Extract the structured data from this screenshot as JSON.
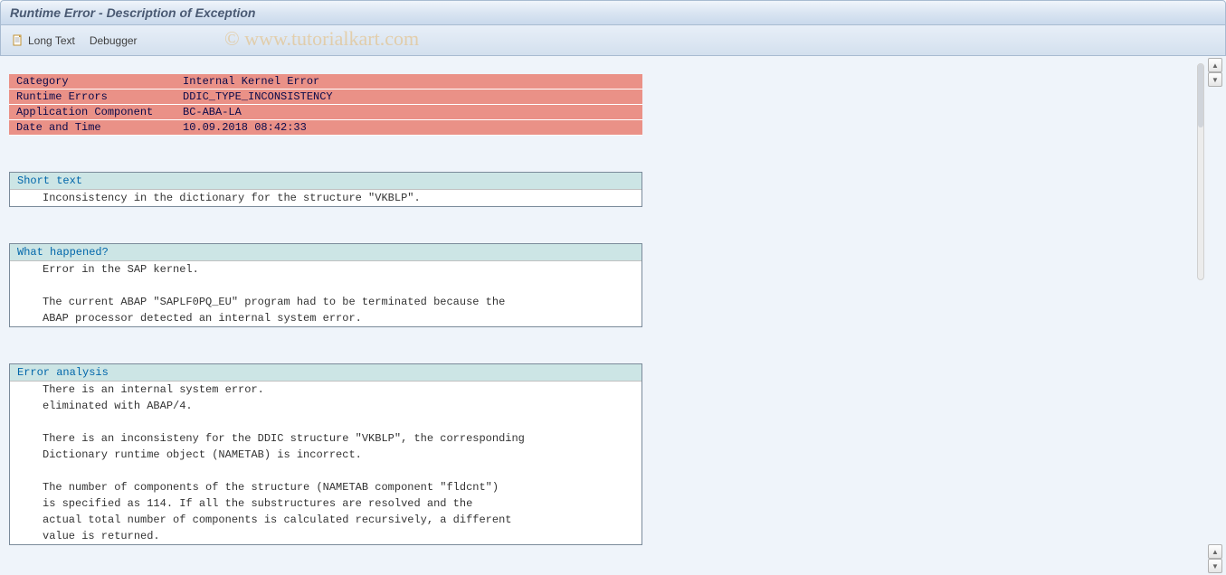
{
  "title": "Runtime Error - Description of Exception",
  "toolbar": {
    "long_text": "Long Text",
    "debugger": "Debugger"
  },
  "watermark": "© www.tutorialkart.com",
  "header": {
    "rows": [
      {
        "label": "Category",
        "value": "Internal Kernel Error"
      },
      {
        "label": "Runtime Errors",
        "value": "DDIC_TYPE_INCONSISTENCY"
      },
      {
        "label": "Application Component",
        "value": "BC-ABA-LA"
      },
      {
        "label": "Date and Time",
        "value": "10.09.2018 08:42:33"
      }
    ]
  },
  "sections": {
    "short_text": {
      "title": "Short text",
      "lines": [
        "Inconsistency in the dictionary for the structure \"VKBLP\"."
      ]
    },
    "what_happened": {
      "title": "What happened?",
      "lines": [
        "Error in the SAP kernel.",
        "",
        "The current ABAP \"SAPLF0PQ_EU\" program had to be terminated because the",
        "ABAP processor detected an internal system error."
      ]
    },
    "error_analysis": {
      "title": "Error analysis",
      "lines": [
        "There is an internal system error.",
        "eliminated with ABAP/4.",
        "",
        "There is an inconsisteny for the DDIC structure \"VKBLP\", the corresponding",
        "Dictionary runtime object (NAMETAB) is incorrect.",
        "",
        "The number of components of the structure (NAMETAB component \"fldcnt\")",
        "is specified as 114. If all the substructures are resolved and the",
        "actual total number of components is calculated recursively, a different",
        "value is returned."
      ]
    }
  }
}
